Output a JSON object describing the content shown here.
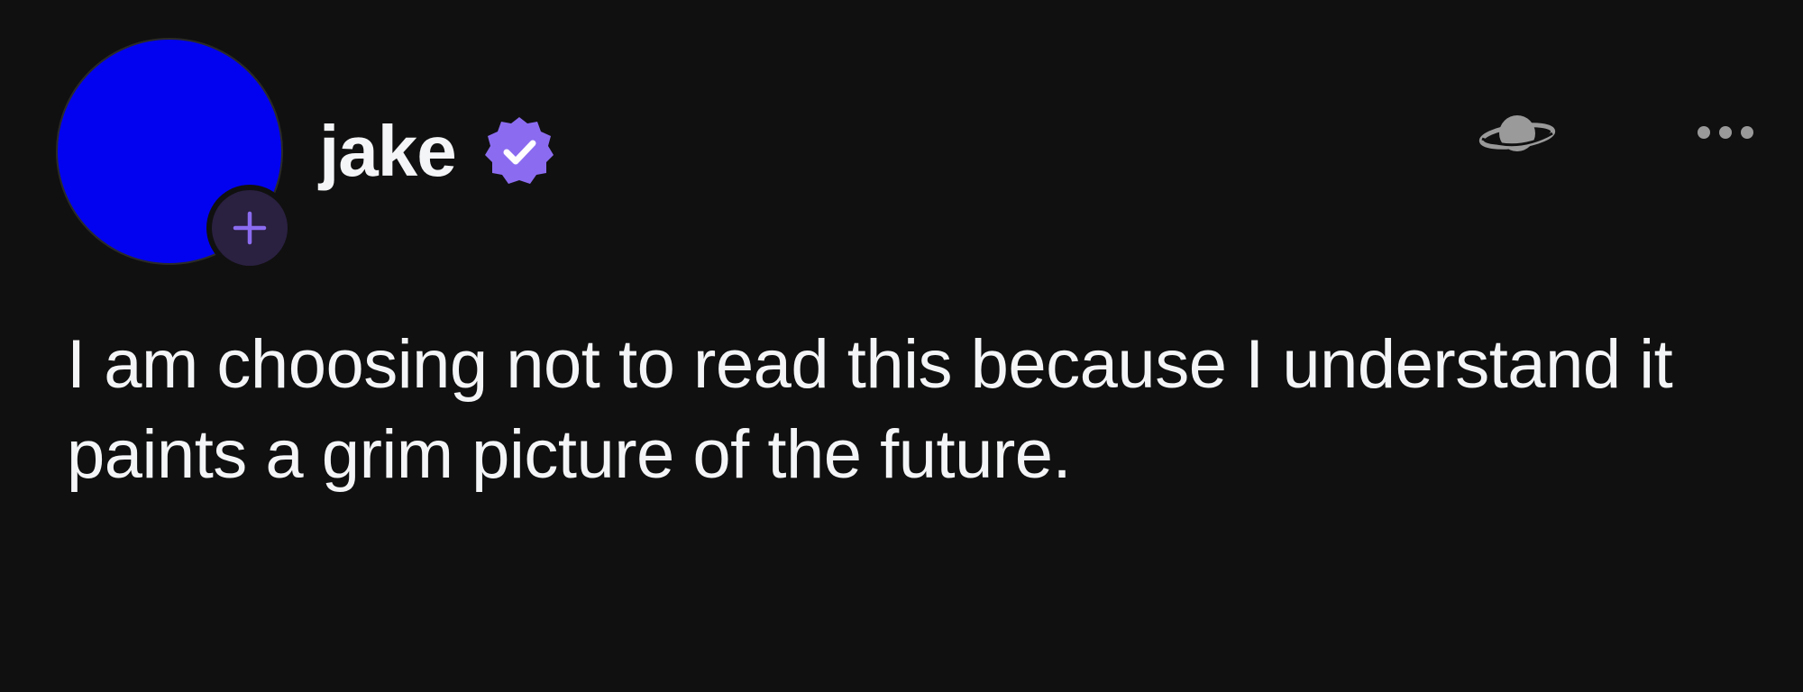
{
  "post": {
    "author": {
      "username": "jake",
      "verified": true,
      "avatar_color": "#0202f0"
    },
    "follow_icon": "plus-icon",
    "actions": {
      "planet_icon": "planet-icon",
      "more_icon": "more-options-icon"
    },
    "text": "I am choosing not to read this because I understand it paints a grim picture of the future."
  },
  "colors": {
    "background": "#101010",
    "text": "#f3f5f7",
    "accent": "#8b6cf0",
    "follow_bg": "#2a2040",
    "icon_gray": "#9a9a9a"
  }
}
